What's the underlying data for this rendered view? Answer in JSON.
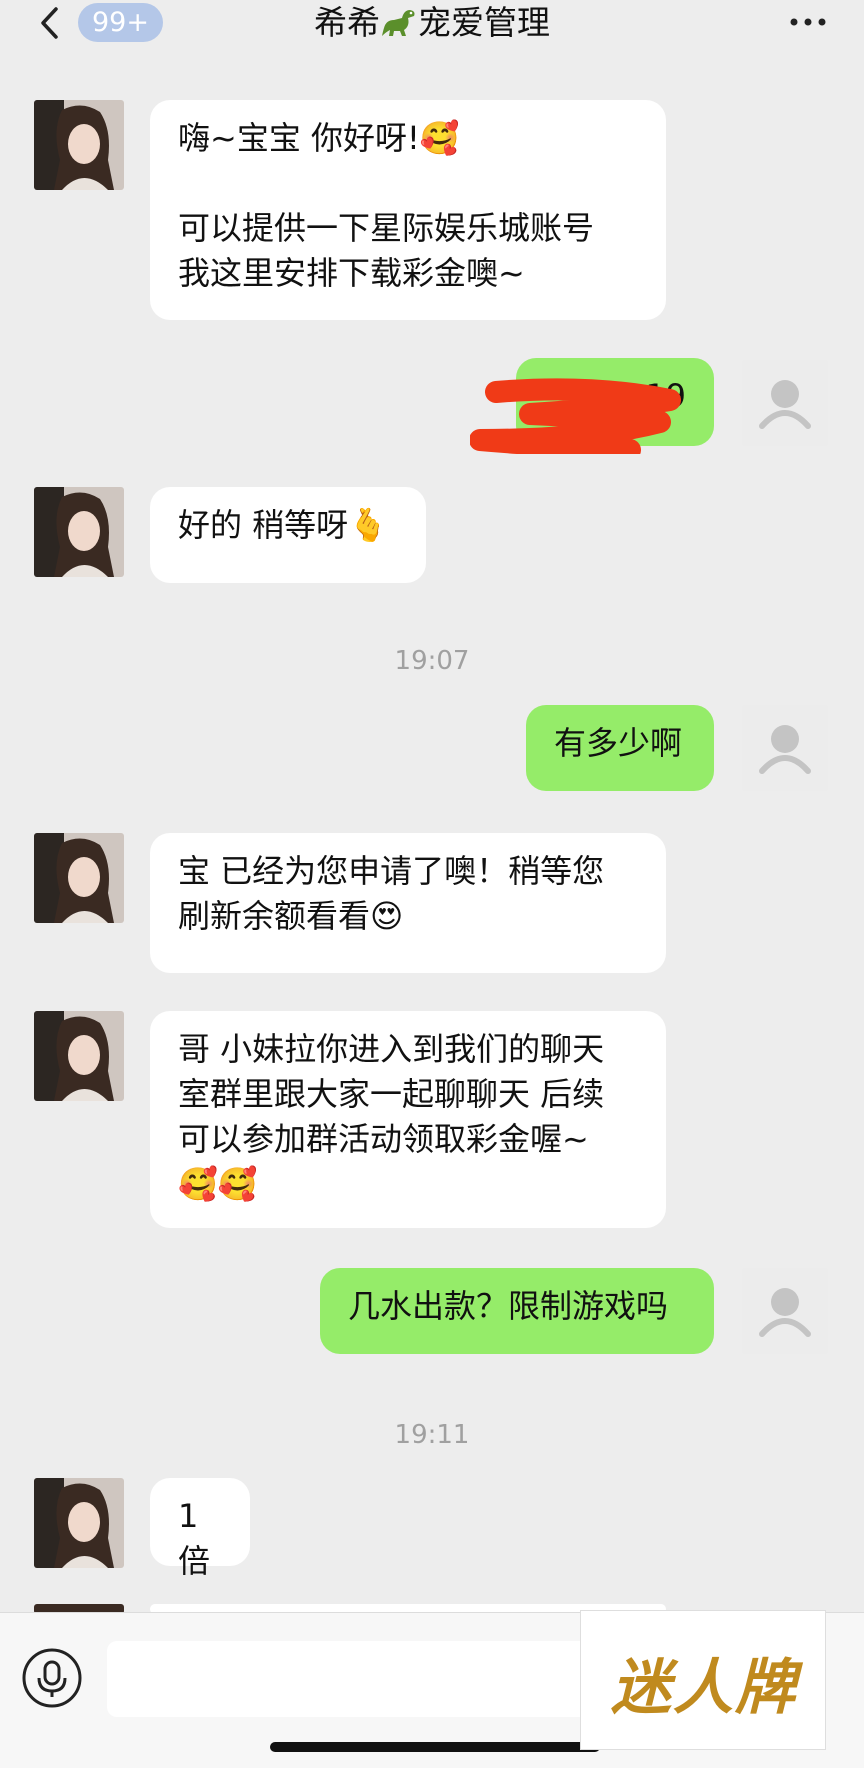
{
  "header": {
    "back_label": "‹",
    "unread_badge": "99+",
    "title_left": "希希",
    "title_right": "宠爱管理",
    "title_emoji": "dinosaur-icon",
    "more_label": "···"
  },
  "messages": [
    {
      "side": "in",
      "text": "嗨~宝宝 你好呀!🥰\n\n可以提供一下星际娱乐城账号\n我这里安排下载彩金噢~"
    },
    {
      "side": "out",
      "text": "19",
      "redacted": true
    },
    {
      "side": "in",
      "text": "好的 稍等呀🫰"
    },
    {
      "side": "time",
      "text": "19:07"
    },
    {
      "side": "out",
      "text": "有多少啊"
    },
    {
      "side": "in",
      "text": "宝 已经为您申请了噢！稍等您\n刷新余额看看😍"
    },
    {
      "side": "in",
      "text": "哥 小妹拉你进入到我们的聊天\n室群里跟大家一起聊聊天 后续\n可以参加群活动领取彩金喔~\n🥰🥰"
    },
    {
      "side": "out",
      "text": "几水出款？限制游戏吗"
    },
    {
      "side": "time",
      "text": "19:11"
    },
    {
      "side": "in",
      "text": "1倍"
    }
  ],
  "input": {
    "placeholder": "",
    "value": ""
  },
  "watermark": {
    "text": "迷人牌"
  },
  "colors": {
    "background": "#ededed",
    "incoming_bubble": "#ffffff",
    "outgoing_bubble": "#95ec69",
    "badge": "#b4c7e8",
    "redaction": "#f03a17"
  }
}
